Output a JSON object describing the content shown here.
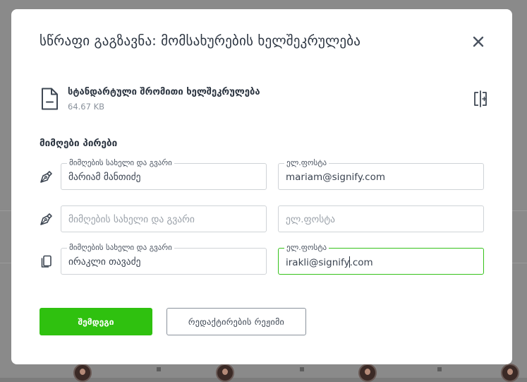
{
  "modal": {
    "title": "სწრაფი გაგზავნა: მომსახურების ხელშეკრულება",
    "close_icon": "close-icon"
  },
  "document": {
    "name": "სტანდარტული შრომითი ხელშეკრულება",
    "size": "64.67 KB",
    "file_icon": "document-icon",
    "replace_icon": "replace-document-icon"
  },
  "recipients": {
    "heading": "მიმღები პირები",
    "name_label": "მიმღების სახელი და გვარი",
    "email_label": "ელ.ფოსტა",
    "rows": [
      {
        "role_icon": "signer-pen-icon",
        "name": "მარიამ მანთიძე",
        "email": "mariam@signify.com"
      },
      {
        "role_icon": "signer-pen-icon",
        "name_placeholder": "მიმღების სახელი და გვარი",
        "email_placeholder": "ელ.ფოსტა"
      },
      {
        "role_icon": "copy-recipient-icon",
        "name": "ირაკლი თავაძე",
        "email_before_caret": "irakli@signify",
        "email_after_caret": ".com"
      }
    ]
  },
  "actions": {
    "next": "შემდეგი",
    "edit_mode": "რედაქტირების რეჟიმი"
  },
  "colors": {
    "primary": "#2fc10f",
    "focus_border": "#35c21a",
    "text": "#2b3440"
  }
}
